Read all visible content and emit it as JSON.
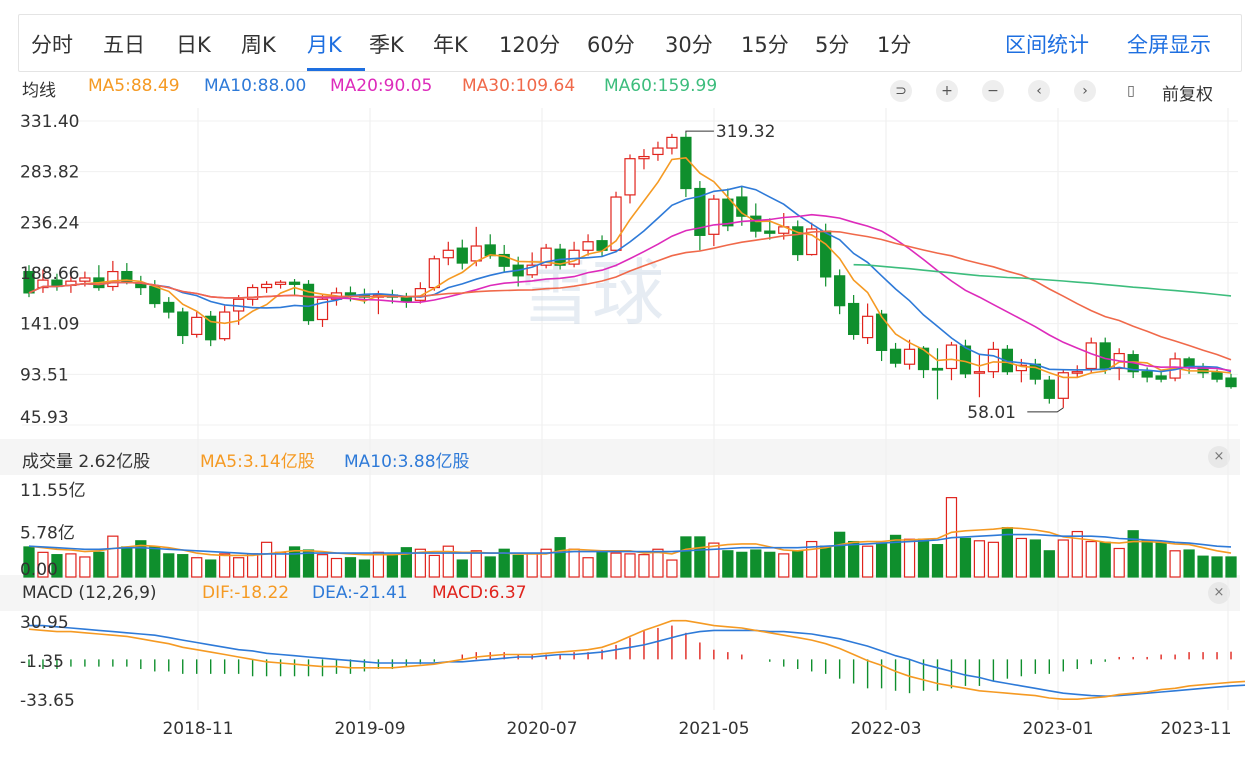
{
  "toolbar": {
    "tabs": [
      "分时",
      "五日",
      "日K",
      "周K",
      "月K",
      "季K",
      "年K",
      "120分",
      "60分",
      "30分",
      "15分",
      "5分",
      "1分"
    ],
    "active_tab": "月K",
    "right_links": [
      "区间统计",
      "全屏显示"
    ]
  },
  "legend": {
    "label": "均线",
    "ma5": "MA5:88.49",
    "ma10": "MA10:88.00",
    "ma20": "MA20:90.05",
    "ma30": "MA30:109.64",
    "ma60": "MA60:159.99",
    "adjust": "前复权"
  },
  "controls": [
    "⊃",
    "+",
    "−",
    "‹",
    "›",
    "▯"
  ],
  "volume": {
    "title": "成交量 2.62亿股",
    "ma5": "MA5:3.14亿股",
    "ma10": "MA10:3.88亿股"
  },
  "macd": {
    "title": "MACD (12,26,9)",
    "dif": "DIF:-18.22",
    "dea": "DEA:-21.41",
    "macd": "MACD:6.37"
  },
  "close_symbol": "×",
  "watermark": "雪球",
  "colors": {
    "up": "#e0241d",
    "down": "#0f8f2d",
    "ma5": "#f59a23",
    "ma10": "#2e7ad8",
    "ma20": "#dd2bbb",
    "ma30": "#f0694a",
    "ma60": "#3dbd7d",
    "accent": "#1e6fe0"
  },
  "chart_data": {
    "type": "candlestick",
    "price_axis": {
      "ticks": [
        "331.40",
        "283.82",
        "236.24",
        "188.66",
        "141.09",
        "93.51",
        "45.93"
      ],
      "ylim": [
        45.93,
        331.4
      ]
    },
    "volume_axis": {
      "ticks": [
        "11.55亿",
        "5.78亿",
        "0.00"
      ],
      "ylim": [
        0,
        11.55
      ]
    },
    "macd_axis": {
      "ticks": [
        "30.95",
        "-1.35",
        "-33.65"
      ],
      "ylim": [
        -33.65,
        30.95
      ]
    },
    "x_ticks": [
      "2018-11",
      "2019-09",
      "2020-07",
      "2021-05",
      "2022-03",
      "2023-01",
      "2023-11"
    ],
    "annotations": [
      {
        "text": "319.32",
        "type": "high"
      },
      {
        "text": "58.01",
        "type": "low"
      }
    ],
    "candles_ohlc": [
      [
        190,
        170,
        196,
        166
      ],
      [
        175,
        182,
        192,
        170
      ],
      [
        182,
        176,
        188,
        172
      ],
      [
        177,
        181,
        189,
        170
      ],
      [
        181,
        184,
        190,
        176
      ],
      [
        184,
        175,
        196,
        172
      ],
      [
        176,
        190,
        200,
        172
      ],
      [
        190,
        180,
        198,
        178
      ],
      [
        179,
        175,
        186,
        168
      ],
      [
        176,
        160,
        182,
        156
      ],
      [
        161,
        152,
        166,
        146
      ],
      [
        152,
        130,
        156,
        122
      ],
      [
        131,
        147,
        152,
        128
      ],
      [
        148,
        126,
        153,
        120
      ],
      [
        127,
        152,
        158,
        125
      ],
      [
        153,
        164,
        168,
        140
      ],
      [
        164,
        175,
        178,
        158
      ],
      [
        175,
        178,
        181,
        170
      ],
      [
        178,
        180,
        182,
        174
      ],
      [
        180,
        178,
        183,
        168
      ],
      [
        178,
        144,
        182,
        140
      ],
      [
        145,
        164,
        168,
        138
      ],
      [
        164,
        170,
        175,
        158
      ],
      [
        170,
        168,
        176,
        162
      ],
      [
        168,
        166,
        174,
        160
      ],
      [
        166,
        168,
        172,
        150
      ],
      [
        168,
        166,
        173,
        160
      ],
      [
        166,
        162,
        170,
        156
      ],
      [
        163,
        174,
        180,
        160
      ],
      [
        175,
        202,
        205,
        172
      ],
      [
        203,
        210,
        218,
        196
      ],
      [
        212,
        198,
        220,
        192
      ],
      [
        200,
        214,
        232,
        195
      ],
      [
        215,
        205,
        225,
        202
      ],
      [
        206,
        195,
        215,
        190
      ],
      [
        196,
        186,
        204,
        176
      ],
      [
        187,
        196,
        208,
        184
      ],
      [
        196,
        212,
        216,
        193
      ],
      [
        211,
        196,
        216,
        192
      ],
      [
        197,
        210,
        218,
        194
      ],
      [
        210,
        218,
        225,
        205
      ],
      [
        219,
        210,
        224,
        204
      ],
      [
        210,
        260,
        265,
        208
      ],
      [
        262,
        296,
        300,
        254
      ],
      [
        296,
        298,
        305,
        286
      ],
      [
        300,
        306,
        312,
        294
      ],
      [
        306,
        316,
        319.32,
        300
      ],
      [
        316,
        268,
        320,
        260
      ],
      [
        268,
        224,
        275,
        210
      ],
      [
        225,
        258,
        262,
        214
      ],
      [
        258,
        233,
        268,
        228
      ],
      [
        260,
        242,
        270,
        233
      ],
      [
        242,
        228,
        254,
        222
      ],
      [
        228,
        226,
        240,
        220
      ],
      [
        226,
        232,
        245,
        220
      ],
      [
        232,
        206,
        238,
        200
      ],
      [
        206,
        230,
        236,
        205
      ],
      [
        228,
        185,
        235,
        176
      ],
      [
        186,
        158,
        192,
        150
      ],
      [
        160,
        131,
        168,
        126
      ],
      [
        128,
        148,
        160,
        122
      ],
      [
        150,
        116,
        154,
        106
      ],
      [
        117,
        104,
        123,
        100
      ],
      [
        103,
        117,
        126,
        98
      ],
      [
        118,
        98,
        120,
        90
      ],
      [
        99,
        98,
        118,
        70
      ],
      [
        99,
        121,
        124,
        88
      ],
      [
        120,
        94,
        126,
        90
      ],
      [
        95,
        96,
        112,
        72
      ],
      [
        96,
        117,
        124,
        90
      ],
      [
        117,
        96,
        121,
        93
      ],
      [
        97,
        102,
        108,
        86
      ],
      [
        103,
        89,
        108,
        84
      ],
      [
        88,
        71,
        92,
        66
      ],
      [
        71,
        95,
        98,
        62
      ],
      [
        96,
        96,
        102,
        90
      ],
      [
        99,
        123,
        128,
        95
      ],
      [
        123,
        98,
        128,
        94
      ],
      [
        99,
        113,
        118,
        88
      ],
      [
        112,
        96,
        116,
        90
      ],
      [
        96,
        91,
        100,
        86
      ],
      [
        92,
        89,
        96,
        86
      ],
      [
        90,
        108,
        114,
        87
      ],
      [
        108,
        100,
        110,
        94
      ],
      [
        100,
        95,
        104,
        90
      ],
      [
        95,
        89,
        98,
        86
      ],
      [
        90,
        82,
        94,
        80
      ]
    ],
    "volume_values": [
      3.9,
      3.2,
      2.9,
      3.0,
      2.6,
      3.2,
      5.3,
      3.9,
      4.7,
      3.9,
      3.0,
      2.9,
      2.5,
      2.2,
      3.0,
      2.5,
      3.0,
      4.5,
      3.2,
      3.9,
      3.5,
      2.9,
      2.4,
      2.5,
      2.2,
      3.2,
      2.8,
      3.8,
      3.6,
      2.8,
      4.0,
      2.2,
      3.4,
      2.6,
      3.6,
      2.8,
      3.0,
      3.6,
      5.1,
      3.6,
      2.5,
      3.4,
      3.1,
      3.0,
      2.9,
      3.6,
      2.2,
      5.2,
      5.2,
      4.4,
      3.4,
      3.2,
      3.5,
      3.2,
      3.0,
      3.3,
      4.6,
      4.0,
      5.8,
      4.6,
      4.0,
      4.4,
      5.4,
      4.9,
      4.9,
      4.2,
      10.3,
      5.0,
      4.7,
      4.5,
      6.4,
      5.0,
      4.8,
      3.4,
      4.8,
      5.9,
      4.6,
      4.5,
      3.7,
      6.0,
      4.7,
      4.4,
      3.4,
      3.5,
      2.7,
      2.6,
      2.6
    ],
    "volume_ma5": [
      4.0,
      3.8,
      3.6,
      3.5,
      3.3,
      3.4,
      3.7,
      3.9,
      4.1,
      4.0,
      3.8,
      3.5,
      3.1,
      2.9,
      2.8,
      2.8,
      2.8,
      3.0,
      3.2,
      3.4,
      3.4,
      3.3,
      3.1,
      3.0,
      2.9,
      2.9,
      2.9,
      3.0,
      3.2,
      3.3,
      3.3,
      3.2,
      3.2,
      3.1,
      3.1,
      3.0,
      3.0,
      3.0,
      3.4,
      3.6,
      3.5,
      3.4,
      3.4,
      3.4,
      3.1,
      3.2,
      3.0,
      3.6,
      3.8,
      4.0,
      4.2,
      4.3,
      4.3,
      3.9,
      3.5,
      3.4,
      3.6,
      3.8,
      4.2,
      4.5,
      4.6,
      4.6,
      4.8,
      4.8,
      4.9,
      5.0,
      5.8,
      6.0,
      6.1,
      6.2,
      6.4,
      6.3,
      6.1,
      5.8,
      5.2,
      5.0,
      4.8,
      4.5,
      4.4,
      4.6,
      4.6,
      4.5,
      4.3,
      4.2,
      3.8,
      3.4,
      3.1
    ],
    "volume_ma10": [
      4.0,
      3.9,
      3.8,
      3.7,
      3.6,
      3.6,
      3.7,
      3.8,
      3.8,
      3.7,
      3.6,
      3.5,
      3.4,
      3.3,
      3.2,
      3.1,
      3.0,
      3.0,
      3.0,
      3.0,
      3.1,
      3.1,
      3.1,
      3.1,
      3.1,
      3.1,
      3.1,
      3.1,
      3.1,
      3.1,
      3.1,
      3.1,
      3.1,
      3.1,
      3.1,
      3.1,
      3.1,
      3.1,
      3.2,
      3.3,
      3.3,
      3.3,
      3.3,
      3.3,
      3.3,
      3.3,
      3.3,
      3.4,
      3.5,
      3.6,
      3.7,
      3.8,
      3.8,
      3.8,
      3.8,
      3.8,
      3.9,
      4.0,
      4.1,
      4.2,
      4.3,
      4.4,
      4.5,
      4.6,
      4.7,
      4.8,
      5.1,
      5.2,
      5.3,
      5.4,
      5.5,
      5.5,
      5.5,
      5.4,
      5.3,
      5.3,
      5.3,
      5.2,
      5.0,
      4.9,
      4.8,
      4.7,
      4.5,
      4.4,
      4.2,
      4.0,
      3.9
    ],
    "macd_dif": [
      25,
      24,
      23,
      23,
      22,
      21,
      20,
      19,
      17,
      15,
      13,
      10,
      8,
      6,
      4,
      2,
      0,
      -2,
      -3,
      -4,
      -5,
      -6,
      -6,
      -7,
      -7,
      -7,
      -7,
      -6,
      -5,
      -4,
      -2,
      0,
      2,
      3,
      4,
      4,
      4,
      5,
      6,
      7,
      8,
      10,
      14,
      19,
      24,
      28,
      32,
      32,
      30,
      28,
      27,
      26,
      24,
      22,
      20,
      18,
      16,
      13,
      9,
      4,
      -1,
      -5,
      -10,
      -14,
      -17,
      -20,
      -22,
      -24,
      -26,
      -27,
      -28,
      -29,
      -30,
      -32,
      -33,
      -33,
      -32,
      -31,
      -29,
      -28,
      -27,
      -25,
      -24,
      -22,
      -21,
      -20,
      -19,
      -18.22
    ],
    "macd_dea": [
      28,
      28,
      27,
      26,
      25,
      24,
      23,
      22,
      21,
      20,
      18,
      16,
      14,
      12,
      10,
      8,
      7,
      5,
      4,
      3,
      2,
      1,
      0,
      -1,
      -2,
      -3,
      -3,
      -3,
      -3,
      -3,
      -2,
      -2,
      -1,
      0,
      1,
      2,
      2,
      3,
      4,
      4,
      5,
      6,
      8,
      10,
      12,
      15,
      18,
      21,
      23,
      24,
      24,
      24,
      24,
      23,
      23,
      22,
      21,
      19,
      17,
      14,
      11,
      7,
      3,
      0,
      -4,
      -7,
      -10,
      -13,
      -15,
      -18,
      -20,
      -22,
      -24,
      -26,
      -28,
      -29,
      -30,
      -30.5,
      -30,
      -29,
      -28,
      -27,
      -26,
      -25,
      -24,
      -23,
      -22,
      -21.41
    ],
    "macd_hist": [
      -6,
      -8,
      -8,
      -6,
      -6,
      -6,
      -6,
      -6,
      -8,
      -10,
      -10,
      -12,
      -12,
      -12,
      -12,
      -12,
      -14,
      -14,
      -14,
      -14,
      -14,
      -14,
      -12,
      -12,
      -10,
      -8,
      -8,
      -6,
      -4,
      -2,
      0,
      4,
      6,
      6,
      6,
      4,
      4,
      4,
      4,
      6,
      6,
      8,
      12,
      18,
      24,
      26,
      28,
      22,
      14,
      8,
      6,
      4,
      0,
      -2,
      -6,
      -8,
      -10,
      -12,
      -16,
      -20,
      -24,
      -24,
      -26,
      -28,
      -26,
      -26,
      -24,
      -22,
      -22,
      -18,
      -16,
      -14,
      -12,
      -12,
      -10,
      -8,
      -4,
      -2,
      2,
      2,
      2,
      4,
      4,
      6,
      6,
      6,
      6.37
    ]
  }
}
